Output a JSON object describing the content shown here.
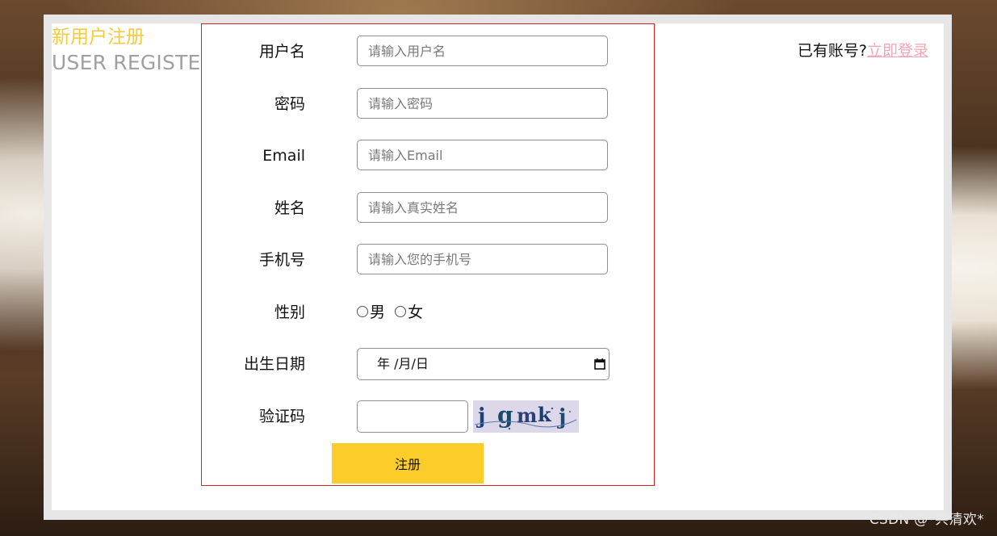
{
  "header": {
    "title_cn": "新用户注册",
    "title_en": "USER REGISTER"
  },
  "login": {
    "prompt": "已有账号?",
    "link_label": "立即登录"
  },
  "form": {
    "username": {
      "label": "用户名",
      "placeholder": "请输入用户名"
    },
    "password": {
      "label": "密码",
      "placeholder": "请输入密码"
    },
    "email": {
      "label": "Email",
      "placeholder": "请输入Email"
    },
    "name": {
      "label": "姓名",
      "placeholder": "请输入真实姓名"
    },
    "phone": {
      "label": "手机号",
      "placeholder": "请输入您的手机号"
    },
    "gender": {
      "label": "性别",
      "options": [
        "男",
        "女"
      ]
    },
    "birthday": {
      "label": "出生日期",
      "value": "年 /月/日"
    },
    "captcha": {
      "label": "验证码",
      "image_text": "jgmkj"
    },
    "submit_label": "注册"
  },
  "watermark": "CSDN @*共清欢*",
  "colors": {
    "accent_yellow": "#fccd2a",
    "title_yellow": "#f4cb3a",
    "form_border": "#d2232a",
    "link_pink": "#f4a6b5"
  }
}
